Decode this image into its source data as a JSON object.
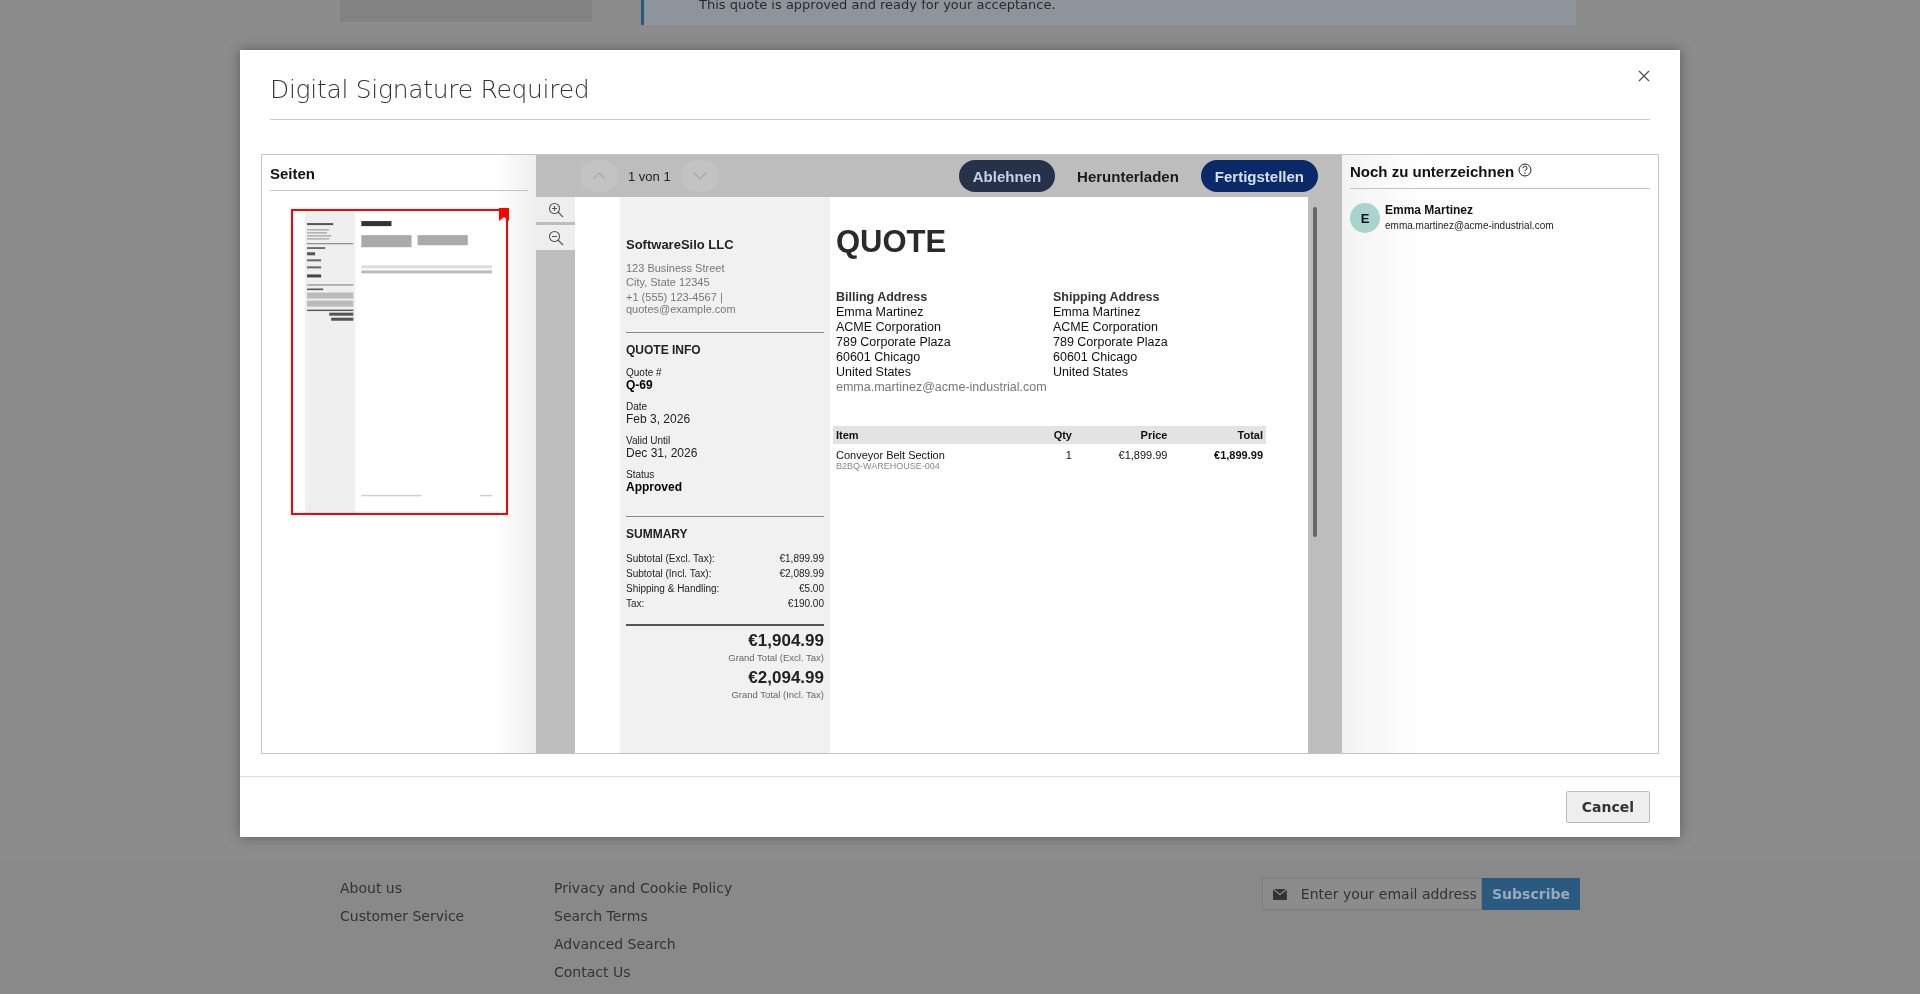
{
  "background": {
    "notice": "This quote is approved and ready for your acceptance.",
    "footer_links": [
      [
        "About us",
        "Customer Service"
      ],
      [
        "Privacy and Cookie Policy",
        "Search Terms",
        "Advanced Search",
        "Contact Us"
      ]
    ],
    "newsletter": {
      "placeholder": "Enter your email address",
      "button": "Subscribe"
    }
  },
  "modal": {
    "title": "Digital Signature Required",
    "pages_panel": {
      "title": "Seiten",
      "pages": [
        {
          "selected": true,
          "bookmarked": true
        }
      ]
    },
    "viewer": {
      "prev_disabled": true,
      "next_disabled": true,
      "page_counter": "1 von 1",
      "buttons": [
        {
          "label": "Ablehnen",
          "kind": "dark"
        },
        {
          "label": "Herunterladen",
          "kind": "plain"
        },
        {
          "label": "Fertigstellen",
          "kind": "primary"
        }
      ],
      "document": {
        "company": "SoftwareSilo LLC",
        "company_lines": [
          "123 Business Street",
          "City, State 12345"
        ],
        "contact_lines": [
          "+1 (555) 123-4567 |",
          "quotes@example.com"
        ],
        "info_title": "QUOTE INFO",
        "info": [
          {
            "label": "Quote #",
            "value": "Q-69",
            "kind": "strong"
          },
          {
            "label": "Date",
            "value": "Feb 3, 2026",
            "kind": "plain"
          },
          {
            "label": "Valid Until",
            "value": "Dec 31, 2026",
            "kind": "plain"
          },
          {
            "label": "Status",
            "value": "Approved",
            "kind": "strong"
          }
        ],
        "summary_title": "SUMMARY",
        "summary": [
          {
            "label": "Subtotal (Excl. Tax):",
            "value": "€1,899.99"
          },
          {
            "label": "Subtotal (Incl. Tax):",
            "value": "€2,089.99"
          },
          {
            "label": "Shipping & Handling:",
            "value": "€5.00"
          },
          {
            "label": "Tax:",
            "value": "€190.00"
          }
        ],
        "grand_totals": [
          {
            "amount": "€1,904.99",
            "label": "Grand Total (Excl. Tax)"
          },
          {
            "amount": "€2,094.99",
            "label": "Grand Total (Incl. Tax)"
          }
        ],
        "title": "QUOTE",
        "addresses": [
          {
            "heading": "Billing Address",
            "lines": [
              "Emma Martinez",
              "ACME Corporation",
              "789 Corporate Plaza",
              "60601 Chicago",
              "United States"
            ],
            "email": "emma.martinez@acme-industrial.com"
          },
          {
            "heading": "Shipping Address",
            "lines": [
              "Emma Martinez",
              "ACME Corporation",
              "789 Corporate Plaza",
              "60601 Chicago",
              "United States"
            ]
          }
        ],
        "table": {
          "columns": [
            "Item",
            "Qty",
            "Price",
            "Total"
          ],
          "rows": [
            {
              "item": "Conveyor Belt Section",
              "sku": "B2BQ-WAREHOUSE-004",
              "qty": "1",
              "price": "€1,899.99",
              "total": "€1,899.99"
            }
          ]
        }
      }
    },
    "signers_panel": {
      "title": "Noch zu unterzeichnen",
      "signers": [
        {
          "initial": "E",
          "name": "Emma Martinez",
          "email": "emma.martinez@acme-industrial.com"
        }
      ]
    },
    "footer_buttons": [
      "Cancel"
    ]
  }
}
